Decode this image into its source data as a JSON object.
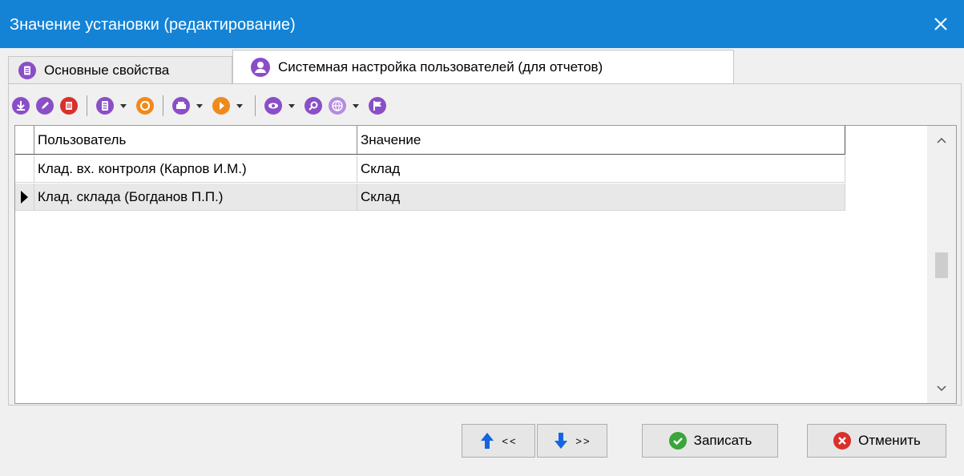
{
  "window": {
    "title": "Значение установки (редактирование)",
    "close_icon": "close-icon"
  },
  "tabs": [
    {
      "label": "Основные свойства",
      "icon": "list-icon",
      "active": false
    },
    {
      "label": "Системная настройка пользователей (для отчетов)",
      "icon": "user-icon",
      "active": true
    }
  ],
  "toolbar": {
    "buttons": [
      "add-icon",
      "edit-icon",
      "delete-icon",
      "list-icon",
      "refresh-icon",
      "print-icon",
      "run-icon",
      "view-icon",
      "search-icon",
      "globe-icon",
      "flag-icon"
    ]
  },
  "grid": {
    "columns": [
      "Пользователь",
      "Значение"
    ],
    "rows": [
      {
        "user": "Клад. вх. контроля (Карпов И.М.)",
        "value": "Склад",
        "current": false
      },
      {
        "user": "Клад. склада (Богданов П.П.)",
        "value": "Склад",
        "current": true
      }
    ]
  },
  "footer": {
    "prev_label": "<<",
    "next_label": ">>",
    "save_label": "Записать",
    "cancel_label": "Отменить"
  },
  "colors": {
    "titlebar": "#1483d6",
    "purple": "#8a4fc7",
    "red": "#d9302c",
    "orange": "#f08a1c",
    "green": "#3aa53a",
    "blue_arrow": "#1565e0"
  }
}
